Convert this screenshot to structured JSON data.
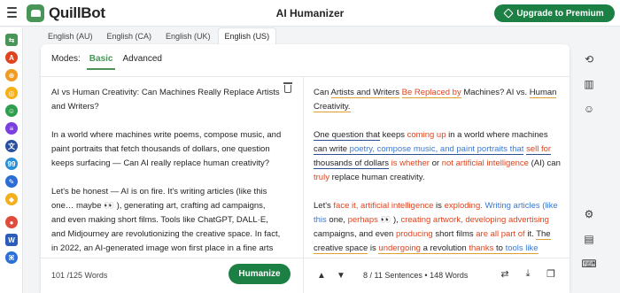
{
  "header": {
    "logo_text": "QuillBot",
    "title": "AI Humanizer",
    "upgrade_label": "Upgrade to Premium"
  },
  "left_rail_icons": [
    {
      "name": "paraphraser-icon",
      "color": "#499557",
      "glyph": "⇆"
    },
    {
      "name": "grammar-checker-icon",
      "color": "#e0441f",
      "glyph": "A"
    },
    {
      "name": "ai-detector-icon",
      "color": "#f29a1f",
      "glyph": "⊕"
    },
    {
      "name": "plagiarism-checker-icon",
      "color": "#f7b016",
      "glyph": "◎"
    },
    {
      "name": "ai-humanizer-icon",
      "color": "#2d9f4d",
      "glyph": "☺"
    },
    {
      "name": "summarizer-icon",
      "color": "#7b3fe0",
      "glyph": "≡"
    },
    {
      "name": "translator-icon",
      "color": "#2a4fa1",
      "glyph": "文"
    },
    {
      "name": "citation-generator-icon",
      "color": "#2a8fd6",
      "glyph": "99"
    },
    {
      "name": "flow-icon",
      "color": "#2b6cd6",
      "glyph": "✎"
    },
    {
      "name": "premium-icon",
      "color": "#f2b01e",
      "glyph": "◆"
    },
    {
      "name": "chrome-extension-icon",
      "color": "#e24b3b",
      "glyph": "●"
    },
    {
      "name": "word-addin-icon",
      "color": "#2b5cb8",
      "glyph": "W"
    },
    {
      "name": "mac-app-icon",
      "color": "#2d6fd8",
      "glyph": "⌘"
    }
  ],
  "tabs": [
    "English (AU)",
    "English (CA)",
    "English (UK)",
    "English (US)"
  ],
  "active_tab": "English (US)",
  "modes": {
    "label": "Modes:",
    "items": [
      "Basic",
      "Advanced"
    ],
    "active": "Basic"
  },
  "input": {
    "paragraphs": [
      "AI vs Human Creativity: Can Machines Really Replace Artists and Writers?",
      "In a world where machines write poems, compose music, and paint portraits that fetch thousands of dollars, one question keeps surfacing — Can AI really replace human creativity?",
      "Let's be honest — AI is on fire. It's writing articles (like this one… maybe 👀 ), generating art, crafting ad campaigns, and even making short films. Tools like ChatGPT, DALL·E, and Midjourney are revolutionizing the creative space. In fact, in 2022, an AI-generated image won first place in a fine arts competition in Colorado. Understandably, some artists and"
    ],
    "word_count": "101 /125 Words"
  },
  "humanize_label": "Humanize",
  "output": {
    "paragraphs": [
      [
        {
          "t": "Can ",
          "c": "plain"
        },
        {
          "t": "Artists and Writers",
          "c": "plain u"
        },
        {
          "t": " ",
          "c": "plain"
        },
        {
          "t": "Be Replaced by",
          "c": "orange u"
        },
        {
          "t": " Machines? AI vs. ",
          "c": "plain"
        },
        {
          "t": "Human Creativity.",
          "c": "plain u"
        }
      ],
      [
        {
          "t": "One question that",
          "c": "plain ub"
        },
        {
          "t": " keeps ",
          "c": "plain"
        },
        {
          "t": "coming up",
          "c": "orange"
        },
        {
          "t": " in a world where machines ",
          "c": "plain"
        },
        {
          "t": "can write ",
          "c": "plain ub"
        },
        {
          "t": "poetry, compose music, and paint portraits that",
          "c": "blue ub"
        },
        {
          "t": " ",
          "c": "plain"
        },
        {
          "t": "sell for",
          "c": "orange ub"
        },
        {
          "t": " ",
          "c": "plain"
        },
        {
          "t": "thousands of dollars",
          "c": "plain ub"
        },
        {
          "t": " ",
          "c": "plain"
        },
        {
          "t": "is whether",
          "c": "orange"
        },
        {
          "t": " or ",
          "c": "plain"
        },
        {
          "t": "not artificial intelligence",
          "c": "orange"
        },
        {
          "t": " (AI) can ",
          "c": "plain"
        },
        {
          "t": "truly",
          "c": "orange"
        },
        {
          "t": " replace human creativity.",
          "c": "plain"
        }
      ],
      [
        {
          "t": "Let's ",
          "c": "plain"
        },
        {
          "t": "face it, artificial intelligence",
          "c": "orange"
        },
        {
          "t": " is ",
          "c": "plain"
        },
        {
          "t": "exploding.",
          "c": "orange"
        },
        {
          "t": " ",
          "c": "plain"
        },
        {
          "t": "Writing articles (like this",
          "c": "blue"
        },
        {
          "t": " one, ",
          "c": "plain"
        },
        {
          "t": "perhaps",
          "c": "orange"
        },
        {
          "t": " 👀 ), ",
          "c": "plain"
        },
        {
          "t": "creating artwork, developing advertising",
          "c": "orange"
        },
        {
          "t": " campaigns, and even ",
          "c": "plain"
        },
        {
          "t": "producing",
          "c": "orange"
        },
        {
          "t": " short films ",
          "c": "plain"
        },
        {
          "t": "are all part of",
          "c": "orange"
        },
        {
          "t": " it. ",
          "c": "plain"
        },
        {
          "t": "The creative space",
          "c": "plain u"
        },
        {
          "t": " is ",
          "c": "plain"
        },
        {
          "t": "undergoing",
          "c": "orange u"
        },
        {
          "t": " a revolution ",
          "c": "plain u"
        },
        {
          "t": "thanks",
          "c": "orange u"
        },
        {
          "t": " to ",
          "c": "plain u"
        },
        {
          "t": "tools like ChatGPT, DALL·E, and Midjourney.",
          "c": "blue u"
        }
      ]
    ],
    "sentences": "8 / 11 Sentences",
    "words": "148 Words"
  }
}
